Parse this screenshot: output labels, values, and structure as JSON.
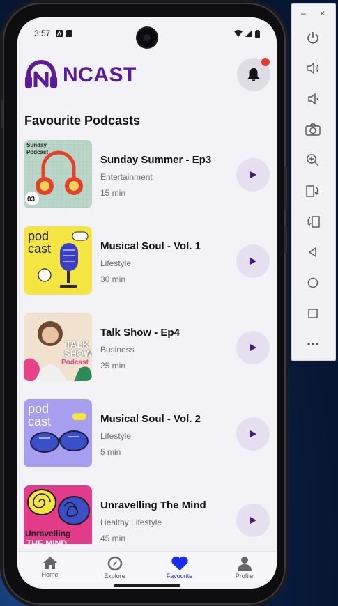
{
  "status_bar": {
    "time": "3:57"
  },
  "header": {
    "app_title": "NCAST"
  },
  "section_title": "Favourite Podcasts",
  "podcasts": [
    {
      "title": "Sunday Summer - Ep3",
      "category": "Entertainment",
      "duration": "15 min",
      "thumb_text": [
        "Sunday",
        "Podcast",
        "03"
      ]
    },
    {
      "title": "Musical Soul - Vol. 1",
      "category": "Lifestyle",
      "duration": "30 min",
      "thumb_text": [
        "pod",
        "cast"
      ]
    },
    {
      "title": "Talk Show - Ep4",
      "category": "Business",
      "duration": "25 min",
      "thumb_text": [
        "TALK",
        "SHOW",
        "Podcast"
      ]
    },
    {
      "title": "Musical Soul - Vol. 2",
      "category": "Lifestyle",
      "duration": "5 min",
      "thumb_text": [
        "pod",
        "cast"
      ]
    },
    {
      "title": "Unravelling The Mind",
      "category": "Healthy Lifestyle",
      "duration": "45 min",
      "thumb_text": [
        "Unravelling",
        "THE MIND"
      ]
    }
  ],
  "bottom_nav": [
    {
      "label": "Home",
      "icon": "home-icon"
    },
    {
      "label": "Explore",
      "icon": "compass-icon"
    },
    {
      "label": "Favourite",
      "icon": "heart-icon",
      "active": true
    },
    {
      "label": "Profile",
      "icon": "person-icon"
    }
  ],
  "colors": {
    "brand": "#5b1b9a",
    "play_button_bg": "#e6dff0",
    "play_icon": "#4a1680",
    "active_nav": "#1a2cf0",
    "notification_dot": "#e53935"
  },
  "emulator_toolbar": {
    "window_controls": [
      "–",
      "×"
    ],
    "buttons": [
      "power-icon",
      "volume-up-icon",
      "volume-down-icon",
      "camera-icon",
      "zoom-in-icon",
      "rotate-left-icon",
      "rotate-right-icon",
      "back-icon",
      "home-circle-icon",
      "overview-icon",
      "more-icon"
    ]
  }
}
